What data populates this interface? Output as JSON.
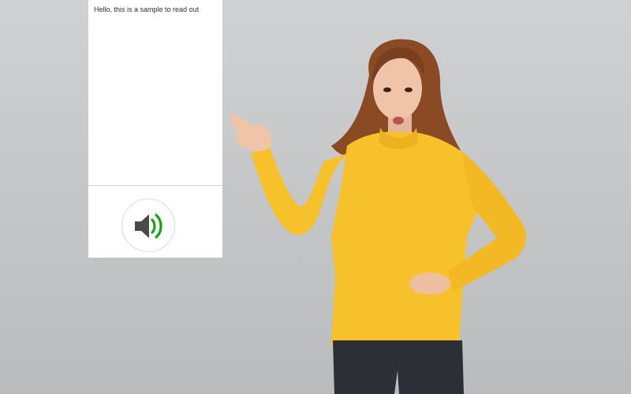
{
  "reader": {
    "sample_text": "Hello, this is a sample to read out"
  },
  "speak_button": {
    "icon": "speaker-volume-icon",
    "accent_color": "#1aa01a",
    "icon_color": "#4a4a4a"
  },
  "photo": {
    "subject": "woman-pointing",
    "sweater_color": "#f6c12b",
    "background_color": "#c5c7c9"
  }
}
